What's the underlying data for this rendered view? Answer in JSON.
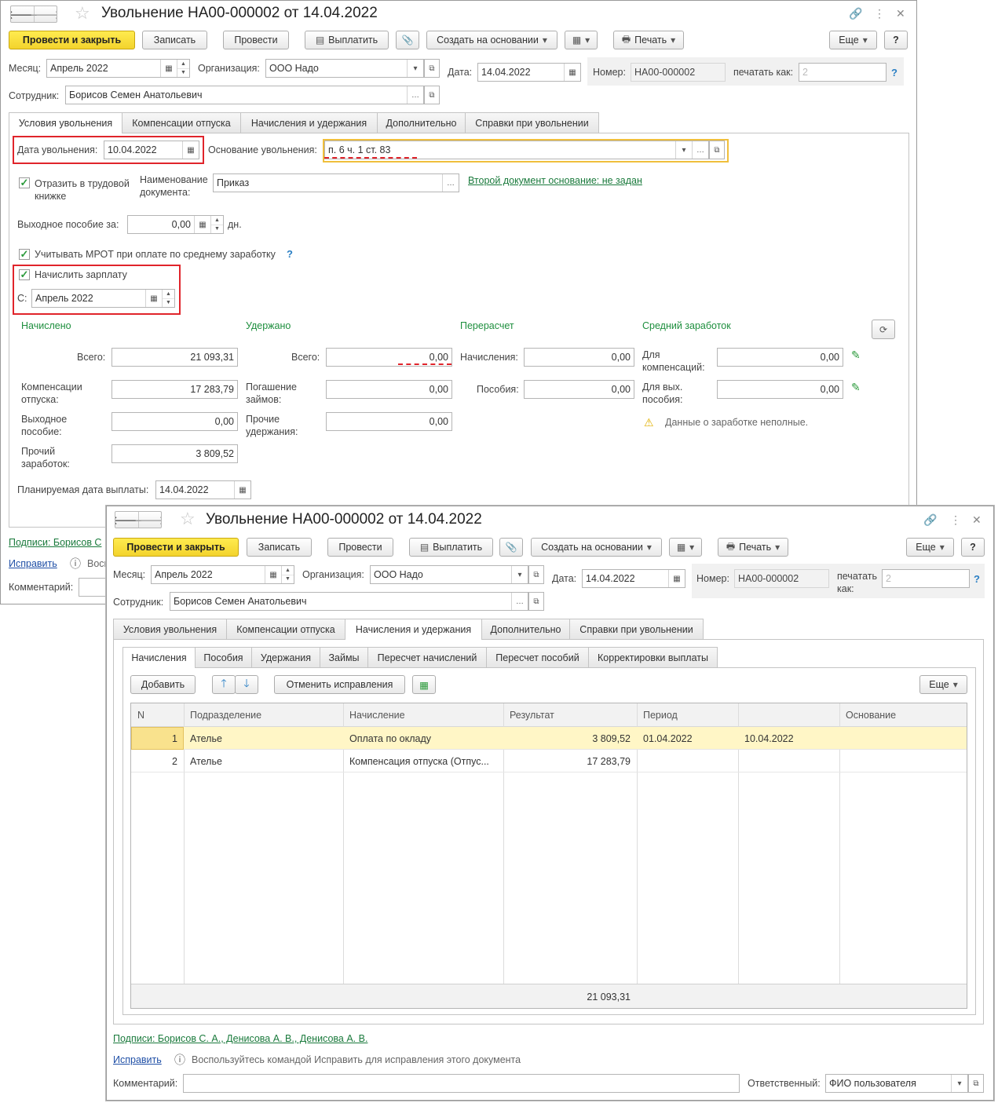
{
  "window1": {
    "title": "Увольнение НА00-000002 от 14.04.2022",
    "toolbar": {
      "post_close": "Провести и закрыть",
      "save": "Записать",
      "post": "Провести",
      "pay": "Выплатить",
      "create_based": "Создать на основании",
      "print": "Печать",
      "more": "Еще",
      "help": "?"
    },
    "month_label": "Месяц:",
    "month_value": "Апрель 2022",
    "org_label": "Организация:",
    "org_value": "ООО Надо",
    "date_label": "Дата:",
    "date_value": "14.04.2022",
    "number_label": "Номер:",
    "number_value": "НА00-000002",
    "print_as_label": "печатать как:",
    "print_as_placeholder": "2",
    "help_q": "?",
    "employee_label": "Сотрудник:",
    "employee_value": "Борисов Семен Анатольевич",
    "tabs": [
      "Условия увольнения",
      "Компенсации отпуска",
      "Начисления и удержания",
      "Дополнительно",
      "Справки при увольнении"
    ],
    "dismissal_date_label": "Дата увольнения:",
    "dismissal_date_value": "10.04.2022",
    "reason_label": "Основание увольнения:",
    "reason_value": "п. 6 ч. 1 ст. 83",
    "workbook_label": "Отразить в трудовой книжке",
    "doc_name_label": "Наименование документа:",
    "doc_name_value": "Приказ",
    "second_doc_link": "Второй документ основание: не задан",
    "severance_label": "Выходное пособие за:",
    "severance_value": "0,00",
    "severance_unit": "дн.",
    "mrot_label": "Учитывать МРОТ при оплате по среднему заработку",
    "mrot_q": "?",
    "accrue_label": "Начислить зарплату",
    "from_label": "С:",
    "from_value": "Апрель 2022",
    "accrued_header": "Начислено",
    "withheld_header": "Удержано",
    "recalc_header": "Перерасчет",
    "avg_header": "Средний заработок",
    "total_label": "Всего:",
    "total_value": "21 093,31",
    "vac_comp_label": "Компенсации отпуска:",
    "vac_comp_value": "17 283,79",
    "sev_pay_label": "Выходное пособие:",
    "sev_pay_value": "0,00",
    "other_earn_label": "Прочий заработок:",
    "other_earn_value": "3 809,52",
    "w_total_label": "Всего:",
    "w_total_value": "0,00",
    "loan_label": "Погашение займов:",
    "loan_value": "0,00",
    "other_ded_label": "Прочие удержания:",
    "other_ded_value": "0,00",
    "r_accr_label": "Начисления:",
    "r_accr_value": "0,00",
    "r_ben_label": "Пособия:",
    "r_ben_value": "0,00",
    "a_comp_label": "Для компенсаций:",
    "a_comp_value": "0,00",
    "a_sev_label": "Для вых. пособия:",
    "a_sev_value": "0,00",
    "warning_text": "Данные о заработке неполные.",
    "planned_date_label": "Планируемая дата выплаты:",
    "planned_date_value": "14.04.2022",
    "signatures_link": "Подписи: Борисов С",
    "fix_link": "Исправить",
    "fix_hint": "Восп",
    "comment_label": "Комментарий:"
  },
  "window2": {
    "title": "Увольнение НА00-000002 от 14.04.2022",
    "toolbar": {
      "post_close": "Провести и закрыть",
      "save": "Записать",
      "post": "Провести",
      "pay": "Выплатить",
      "create_based": "Создать на основании",
      "print": "Печать",
      "more": "Еще",
      "help": "?"
    },
    "month_label": "Месяц:",
    "month_value": "Апрель 2022",
    "org_label": "Организация:",
    "org_value": "ООО Надо",
    "date_label": "Дата:",
    "date_value": "14.04.2022",
    "number_label": "Номер:",
    "number_value": "НА00-000002",
    "print_as_label": "печатать как:",
    "print_as_placeholder": "2",
    "help_q": "?",
    "employee_label": "Сотрудник:",
    "employee_value": "Борисов Семен Анатольевич",
    "tabs": [
      "Условия увольнения",
      "Компенсации отпуска",
      "Начисления и удержания",
      "Дополнительно",
      "Справки при увольнении"
    ],
    "subtabs": [
      "Начисления",
      "Пособия",
      "Удержания",
      "Займы",
      "Пересчет начислений",
      "Пересчет пособий",
      "Корректировки выплаты"
    ],
    "add_button": "Добавить",
    "cancel_fix_button": "Отменить исправления",
    "more_button": "Еще",
    "columns": [
      "N",
      "Подразделение",
      "Начисление",
      "Результат",
      "Период",
      "",
      "Основание"
    ],
    "rows": [
      {
        "n": "1",
        "dept": "Ателье",
        "accrual": "Оплата по окладу",
        "result": "3 809,52",
        "from": "01.04.2022",
        "to": "10.04.2022",
        "basis": ""
      },
      {
        "n": "2",
        "dept": "Ателье",
        "accrual": "Компенсация отпуска (Отпус...",
        "result": "17 283,79",
        "from": "",
        "to": "",
        "basis": ""
      }
    ],
    "footer_total": "21 093,31",
    "signatures_link": "Подписи: Борисов С. А., Денисова А. В., Денисова А. В.",
    "fix_link": "Исправить",
    "fix_hint": "Воспользуйтесь командой Исправить для исправления этого документа",
    "comment_label": "Комментарий:",
    "responsible_label": "Ответственный:",
    "responsible_value": "ФИО пользователя"
  },
  "colors": {
    "accent_yellow": "#f7dc3a",
    "link_green": "#1a7a3c",
    "highlight_red": "#e0242b",
    "row_selected": "#fff6c6"
  }
}
